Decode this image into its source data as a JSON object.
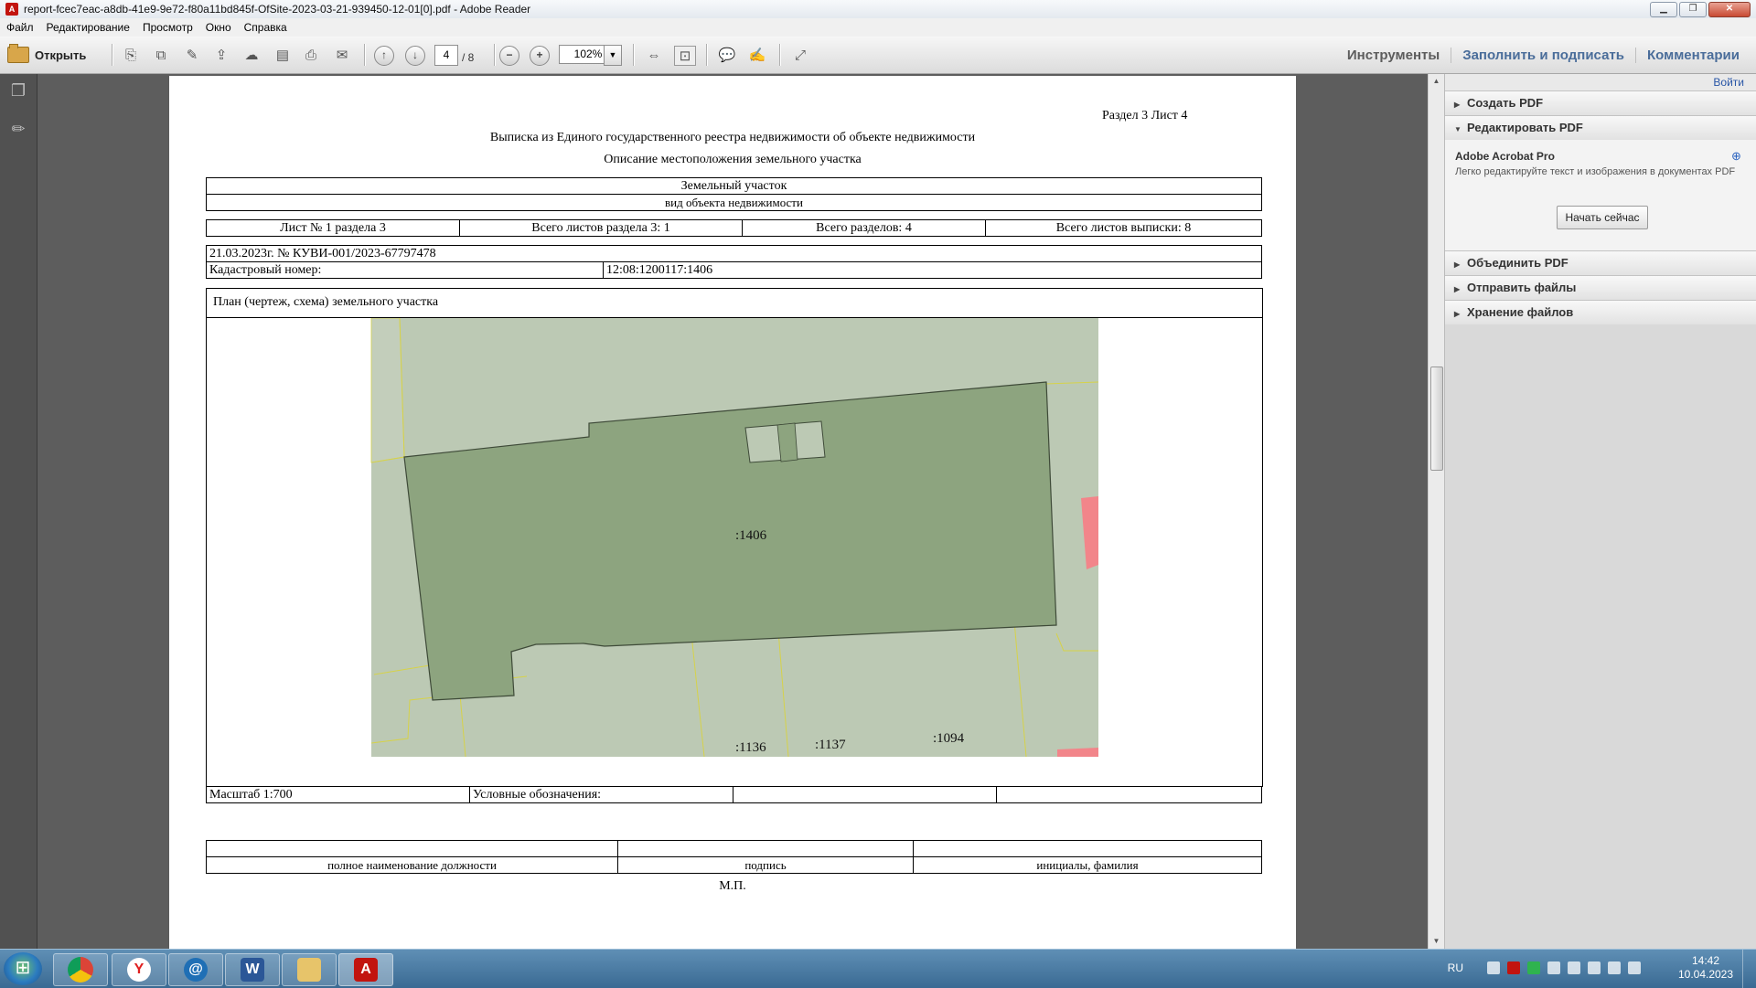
{
  "window": {
    "title": "report-fcec7eac-a8db-41e9-9e72-f80a11bd845f-OfSite-2023-03-21-939450-12-01[0].pdf - Adobe Reader",
    "controls": {
      "minimize": "▁",
      "maximize": "❐",
      "close": "✕"
    }
  },
  "menu": [
    "Файл",
    "Редактирование",
    "Просмотр",
    "Окно",
    "Справка"
  ],
  "toolbar": {
    "open_label": "Открыть",
    "page_current": "4",
    "page_total": "/ 8",
    "zoom": "102%",
    "zoom_arrow": "▼",
    "nav_up": "↑",
    "nav_down": "↓",
    "zoom_out": "−",
    "zoom_in": "+",
    "tools_label": "Инструменты",
    "fill_sign_label": "Заполнить и подписать",
    "comments_label": "Комментарии"
  },
  "document": {
    "header_right": "Раздел 3    Лист 4",
    "title": "Выписка из Единого государственного реестра недвижимости об объекте недвижимости",
    "subtitle": "Описание местоположения земельного участка",
    "object_type": "Земельный участок",
    "object_type_caption": "вид объекта недвижимости",
    "sheet_info": [
      "Лист № 1 раздела 3",
      "Всего листов раздела 3: 1",
      "Всего разделов: 4",
      "Всего листов выписки: 8"
    ],
    "date_number": "21.03.2023г. № КУВИ-001/2023-67797478",
    "cadastral_label": "Кадастровый номер:",
    "cadastral_value": "12:08:1200117:1406",
    "plan_heading": "План (чертеж, схема) земельного участка",
    "plan_labels": {
      "main": ":1406",
      "p1": ":1136",
      "p2": ":1137",
      "p3": ":1094"
    },
    "scale": "Масштаб 1:700",
    "legend_label": "Условные обозначения:",
    "sign_captions": [
      "полное наименование должности",
      "подпись",
      "инициалы, фамилия"
    ],
    "stamp": "М.П."
  },
  "right_panel": {
    "login": "Войти",
    "sections": [
      "Создать PDF",
      "Редактировать PDF",
      "Объединить PDF",
      "Отправить файлы",
      "Хранение файлов"
    ],
    "promo_title": "Adobe Acrobat Pro",
    "promo_desc": "Легко редактируйте текст и изображения в документах PDF",
    "promo_button": "Начать сейчас"
  },
  "taskbar": {
    "apps": [
      "chrome",
      "yandex-browser",
      "mail",
      "word",
      "explorer",
      "adobe-reader"
    ],
    "lang": "RU",
    "time": "14:42",
    "date": "10.04.2023"
  }
}
